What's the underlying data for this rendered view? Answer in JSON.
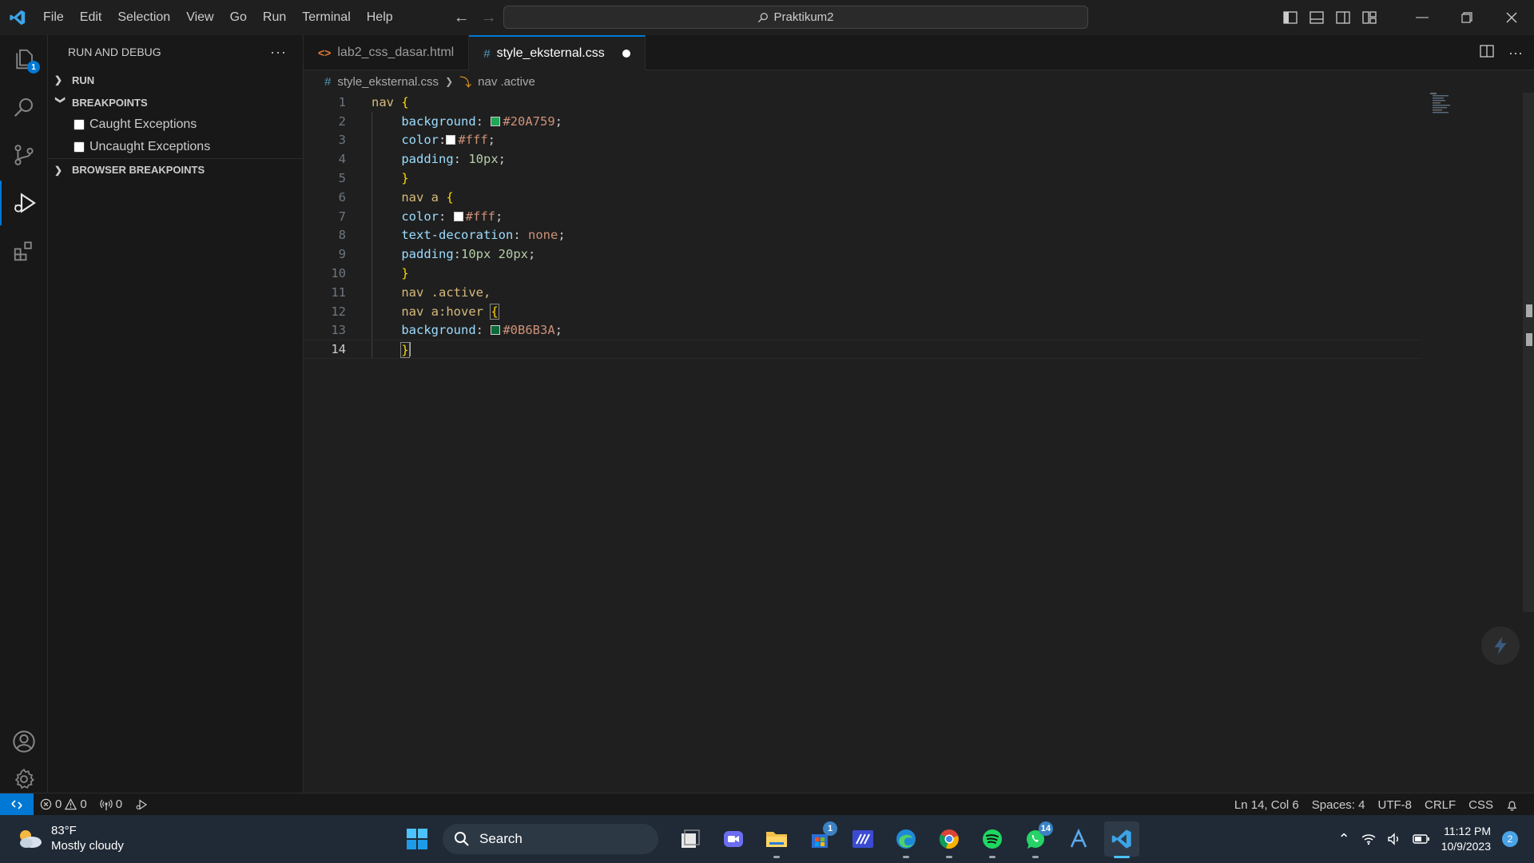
{
  "menu": [
    "File",
    "Edit",
    "Selection",
    "View",
    "Go",
    "Run",
    "Terminal",
    "Help"
  ],
  "command_center": "Praktikum2",
  "activity_badge": "1",
  "sidebar": {
    "title": "RUN AND DEBUG",
    "sections": {
      "run": "RUN",
      "breakpoints": "BREAKPOINTS",
      "browser_breakpoints": "BROWSER BREAKPOINTS"
    },
    "breakpoints": [
      "Caught Exceptions",
      "Uncaught Exceptions"
    ]
  },
  "tabs": [
    {
      "label": "lab2_css_dasar.html"
    },
    {
      "label": "style_eksternal.css"
    }
  ],
  "breadcrumb": {
    "file": "style_eksternal.css",
    "symbol": "nav .active"
  },
  "colors": {
    "swatch_green": "#20A759",
    "swatch_white": "#ffffff",
    "swatch_dark_green": "#0B6B3A",
    "accent": "#0078d4"
  },
  "code": [
    {
      "n": "1"
    },
    {
      "n": "2"
    },
    {
      "n": "3"
    },
    {
      "n": "4"
    },
    {
      "n": "5"
    },
    {
      "n": "6"
    },
    {
      "n": "7"
    },
    {
      "n": "8"
    },
    {
      "n": "9"
    },
    {
      "n": "10"
    },
    {
      "n": "11"
    },
    {
      "n": "12"
    },
    {
      "n": "13"
    },
    {
      "n": "14"
    }
  ],
  "code_text": {
    "l1_sel": "nav",
    "l2_prop": "background",
    "l2_val": "#20A759",
    "l3_prop": "color",
    "l3_val": "#fff",
    "l4_prop": "padding",
    "l4_val": "10px",
    "l6_sel": "nav a",
    "l7_prop": "color",
    "l7_val": "#fff",
    "l8_prop": "text-decoration",
    "l8_val": "none",
    "l9_prop": "padding",
    "l9_val": "10px 20px",
    "l11_sel": "nav .active,",
    "l12_sel": "nav a:hover",
    "l13_prop": "background",
    "l13_val": "#0B6B3A"
  },
  "status": {
    "errors": "0",
    "warnings": "0",
    "ports": "0",
    "position": "Ln 14, Col 6",
    "spaces": "Spaces: 4",
    "encoding": "UTF-8",
    "eol": "CRLF",
    "language": "CSS"
  },
  "taskbar": {
    "weather_temp": "83°F",
    "weather_desc": "Mostly cloudy",
    "search": "Search",
    "store_badge": "1",
    "whatsapp_badge": "14",
    "time": "11:12 PM",
    "date": "10/9/2023",
    "notifications": "2"
  }
}
